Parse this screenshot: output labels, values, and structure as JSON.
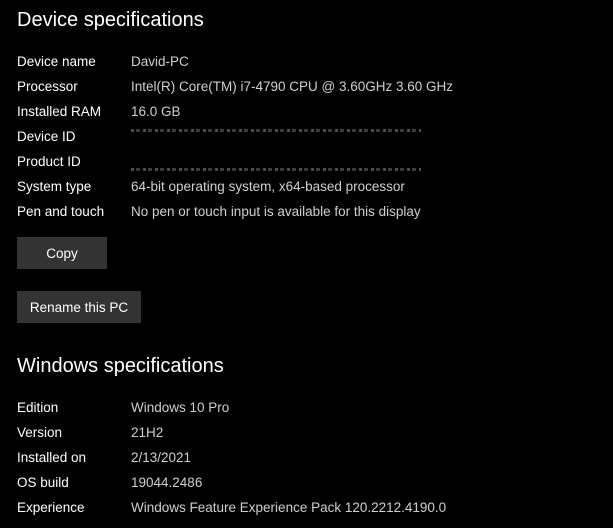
{
  "device_specs": {
    "title": "Device specifications",
    "rows": [
      {
        "label": "Device name",
        "value": "David-PC"
      },
      {
        "label": "Processor",
        "value": "Intel(R) Core(TM) i7-4790 CPU @ 3.60GHz   3.60 GHz"
      },
      {
        "label": "Installed RAM",
        "value": "16.0 GB"
      },
      {
        "label": "Device ID",
        "value": ""
      },
      {
        "label": "Product ID",
        "value": ""
      },
      {
        "label": "System type",
        "value": "64-bit operating system, x64-based processor"
      },
      {
        "label": "Pen and touch",
        "value": "No pen or touch input is available for this display"
      }
    ],
    "copy_label": "Copy",
    "rename_label": "Rename this PC"
  },
  "windows_specs": {
    "title": "Windows specifications",
    "rows": [
      {
        "label": "Edition",
        "value": "Windows 10 Pro"
      },
      {
        "label": "Version",
        "value": "21H2"
      },
      {
        "label": "Installed on",
        "value": "2/13/2021"
      },
      {
        "label": "OS build",
        "value": "19044.2486"
      },
      {
        "label": "Experience",
        "value": "Windows Feature Experience Pack 120.2212.4190.0"
      }
    ]
  },
  "colors": {
    "background": "#000000",
    "label": "#ffffff",
    "value": "#cfcfcf",
    "button": "#333333"
  }
}
